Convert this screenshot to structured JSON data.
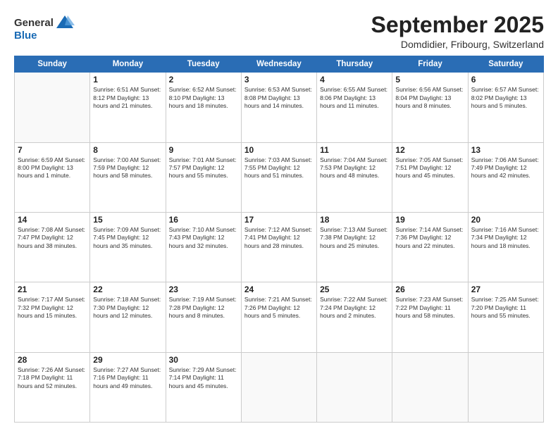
{
  "logo": {
    "general": "General",
    "blue": "Blue"
  },
  "title": "September 2025",
  "location": "Domdidier, Fribourg, Switzerland",
  "days_header": [
    "Sunday",
    "Monday",
    "Tuesday",
    "Wednesday",
    "Thursday",
    "Friday",
    "Saturday"
  ],
  "weeks": [
    [
      {
        "day": "",
        "info": ""
      },
      {
        "day": "1",
        "info": "Sunrise: 6:51 AM\nSunset: 8:12 PM\nDaylight: 13 hours\nand 21 minutes."
      },
      {
        "day": "2",
        "info": "Sunrise: 6:52 AM\nSunset: 8:10 PM\nDaylight: 13 hours\nand 18 minutes."
      },
      {
        "day": "3",
        "info": "Sunrise: 6:53 AM\nSunset: 8:08 PM\nDaylight: 13 hours\nand 14 minutes."
      },
      {
        "day": "4",
        "info": "Sunrise: 6:55 AM\nSunset: 8:06 PM\nDaylight: 13 hours\nand 11 minutes."
      },
      {
        "day": "5",
        "info": "Sunrise: 6:56 AM\nSunset: 8:04 PM\nDaylight: 13 hours\nand 8 minutes."
      },
      {
        "day": "6",
        "info": "Sunrise: 6:57 AM\nSunset: 8:02 PM\nDaylight: 13 hours\nand 5 minutes."
      }
    ],
    [
      {
        "day": "7",
        "info": "Sunrise: 6:59 AM\nSunset: 8:00 PM\nDaylight: 13 hours\nand 1 minute."
      },
      {
        "day": "8",
        "info": "Sunrise: 7:00 AM\nSunset: 7:59 PM\nDaylight: 12 hours\nand 58 minutes."
      },
      {
        "day": "9",
        "info": "Sunrise: 7:01 AM\nSunset: 7:57 PM\nDaylight: 12 hours\nand 55 minutes."
      },
      {
        "day": "10",
        "info": "Sunrise: 7:03 AM\nSunset: 7:55 PM\nDaylight: 12 hours\nand 51 minutes."
      },
      {
        "day": "11",
        "info": "Sunrise: 7:04 AM\nSunset: 7:53 PM\nDaylight: 12 hours\nand 48 minutes."
      },
      {
        "day": "12",
        "info": "Sunrise: 7:05 AM\nSunset: 7:51 PM\nDaylight: 12 hours\nand 45 minutes."
      },
      {
        "day": "13",
        "info": "Sunrise: 7:06 AM\nSunset: 7:49 PM\nDaylight: 12 hours\nand 42 minutes."
      }
    ],
    [
      {
        "day": "14",
        "info": "Sunrise: 7:08 AM\nSunset: 7:47 PM\nDaylight: 12 hours\nand 38 minutes."
      },
      {
        "day": "15",
        "info": "Sunrise: 7:09 AM\nSunset: 7:45 PM\nDaylight: 12 hours\nand 35 minutes."
      },
      {
        "day": "16",
        "info": "Sunrise: 7:10 AM\nSunset: 7:43 PM\nDaylight: 12 hours\nand 32 minutes."
      },
      {
        "day": "17",
        "info": "Sunrise: 7:12 AM\nSunset: 7:41 PM\nDaylight: 12 hours\nand 28 minutes."
      },
      {
        "day": "18",
        "info": "Sunrise: 7:13 AM\nSunset: 7:38 PM\nDaylight: 12 hours\nand 25 minutes."
      },
      {
        "day": "19",
        "info": "Sunrise: 7:14 AM\nSunset: 7:36 PM\nDaylight: 12 hours\nand 22 minutes."
      },
      {
        "day": "20",
        "info": "Sunrise: 7:16 AM\nSunset: 7:34 PM\nDaylight: 12 hours\nand 18 minutes."
      }
    ],
    [
      {
        "day": "21",
        "info": "Sunrise: 7:17 AM\nSunset: 7:32 PM\nDaylight: 12 hours\nand 15 minutes."
      },
      {
        "day": "22",
        "info": "Sunrise: 7:18 AM\nSunset: 7:30 PM\nDaylight: 12 hours\nand 12 minutes."
      },
      {
        "day": "23",
        "info": "Sunrise: 7:19 AM\nSunset: 7:28 PM\nDaylight: 12 hours\nand 8 minutes."
      },
      {
        "day": "24",
        "info": "Sunrise: 7:21 AM\nSunset: 7:26 PM\nDaylight: 12 hours\nand 5 minutes."
      },
      {
        "day": "25",
        "info": "Sunrise: 7:22 AM\nSunset: 7:24 PM\nDaylight: 12 hours\nand 2 minutes."
      },
      {
        "day": "26",
        "info": "Sunrise: 7:23 AM\nSunset: 7:22 PM\nDaylight: 11 hours\nand 58 minutes."
      },
      {
        "day": "27",
        "info": "Sunrise: 7:25 AM\nSunset: 7:20 PM\nDaylight: 11 hours\nand 55 minutes."
      }
    ],
    [
      {
        "day": "28",
        "info": "Sunrise: 7:26 AM\nSunset: 7:18 PM\nDaylight: 11 hours\nand 52 minutes."
      },
      {
        "day": "29",
        "info": "Sunrise: 7:27 AM\nSunset: 7:16 PM\nDaylight: 11 hours\nand 49 minutes."
      },
      {
        "day": "30",
        "info": "Sunrise: 7:29 AM\nSunset: 7:14 PM\nDaylight: 11 hours\nand 45 minutes."
      },
      {
        "day": "",
        "info": ""
      },
      {
        "day": "",
        "info": ""
      },
      {
        "day": "",
        "info": ""
      },
      {
        "day": "",
        "info": ""
      }
    ]
  ]
}
